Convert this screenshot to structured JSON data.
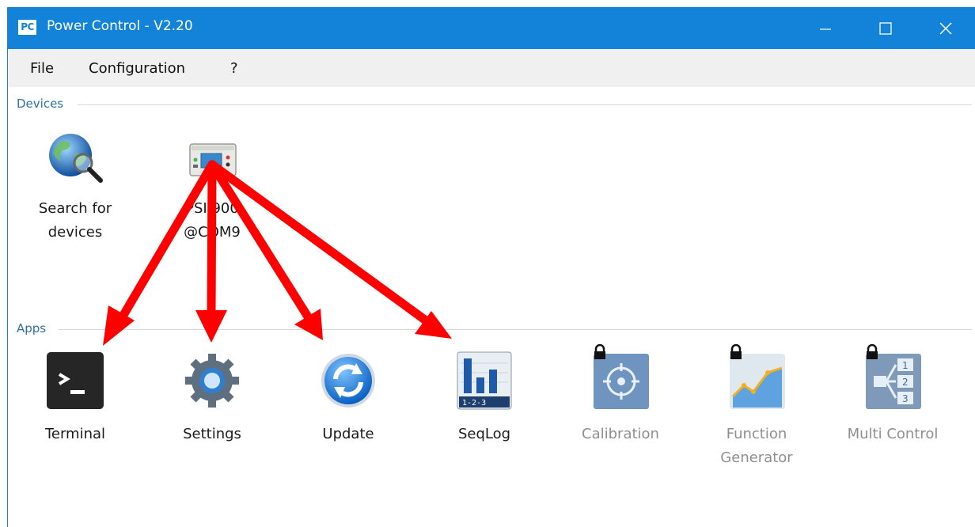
{
  "window": {
    "title": "Power Control - V2.20",
    "app_icon_text": "PC"
  },
  "menu": {
    "items": [
      "File",
      "Configuration",
      "?"
    ]
  },
  "devices": {
    "section_label": "Devices",
    "items": [
      {
        "label_line1": "Search for",
        "label_line2": "devices",
        "icon": "globe-search-icon"
      },
      {
        "label_line1": "PSI 900",
        "label_line2": "@COM9",
        "icon": "power-supply-icon"
      }
    ]
  },
  "apps": {
    "section_label": "Apps",
    "items": [
      {
        "label_line1": "Terminal",
        "label_line2": "",
        "icon": "terminal-icon",
        "locked": false
      },
      {
        "label_line1": "Settings",
        "label_line2": "",
        "icon": "gear-icon",
        "locked": false
      },
      {
        "label_line1": "Update",
        "label_line2": "",
        "icon": "update-icon",
        "locked": false
      },
      {
        "label_line1": "SeqLog",
        "label_line2": "",
        "icon": "seqlog-icon",
        "locked": false
      },
      {
        "label_line1": "Calibration",
        "label_line2": "",
        "icon": "calibration-icon",
        "locked": true
      },
      {
        "label_line1": "Function",
        "label_line2": "Generator",
        "icon": "function-generator-icon",
        "locked": true
      },
      {
        "label_line1": "Multi Control",
        "label_line2": "",
        "icon": "multi-control-icon",
        "locked": true
      }
    ]
  },
  "colors": {
    "titlebar": "#1283d9",
    "arrow": "#ff0000",
    "section_label": "#2f6fa8"
  }
}
